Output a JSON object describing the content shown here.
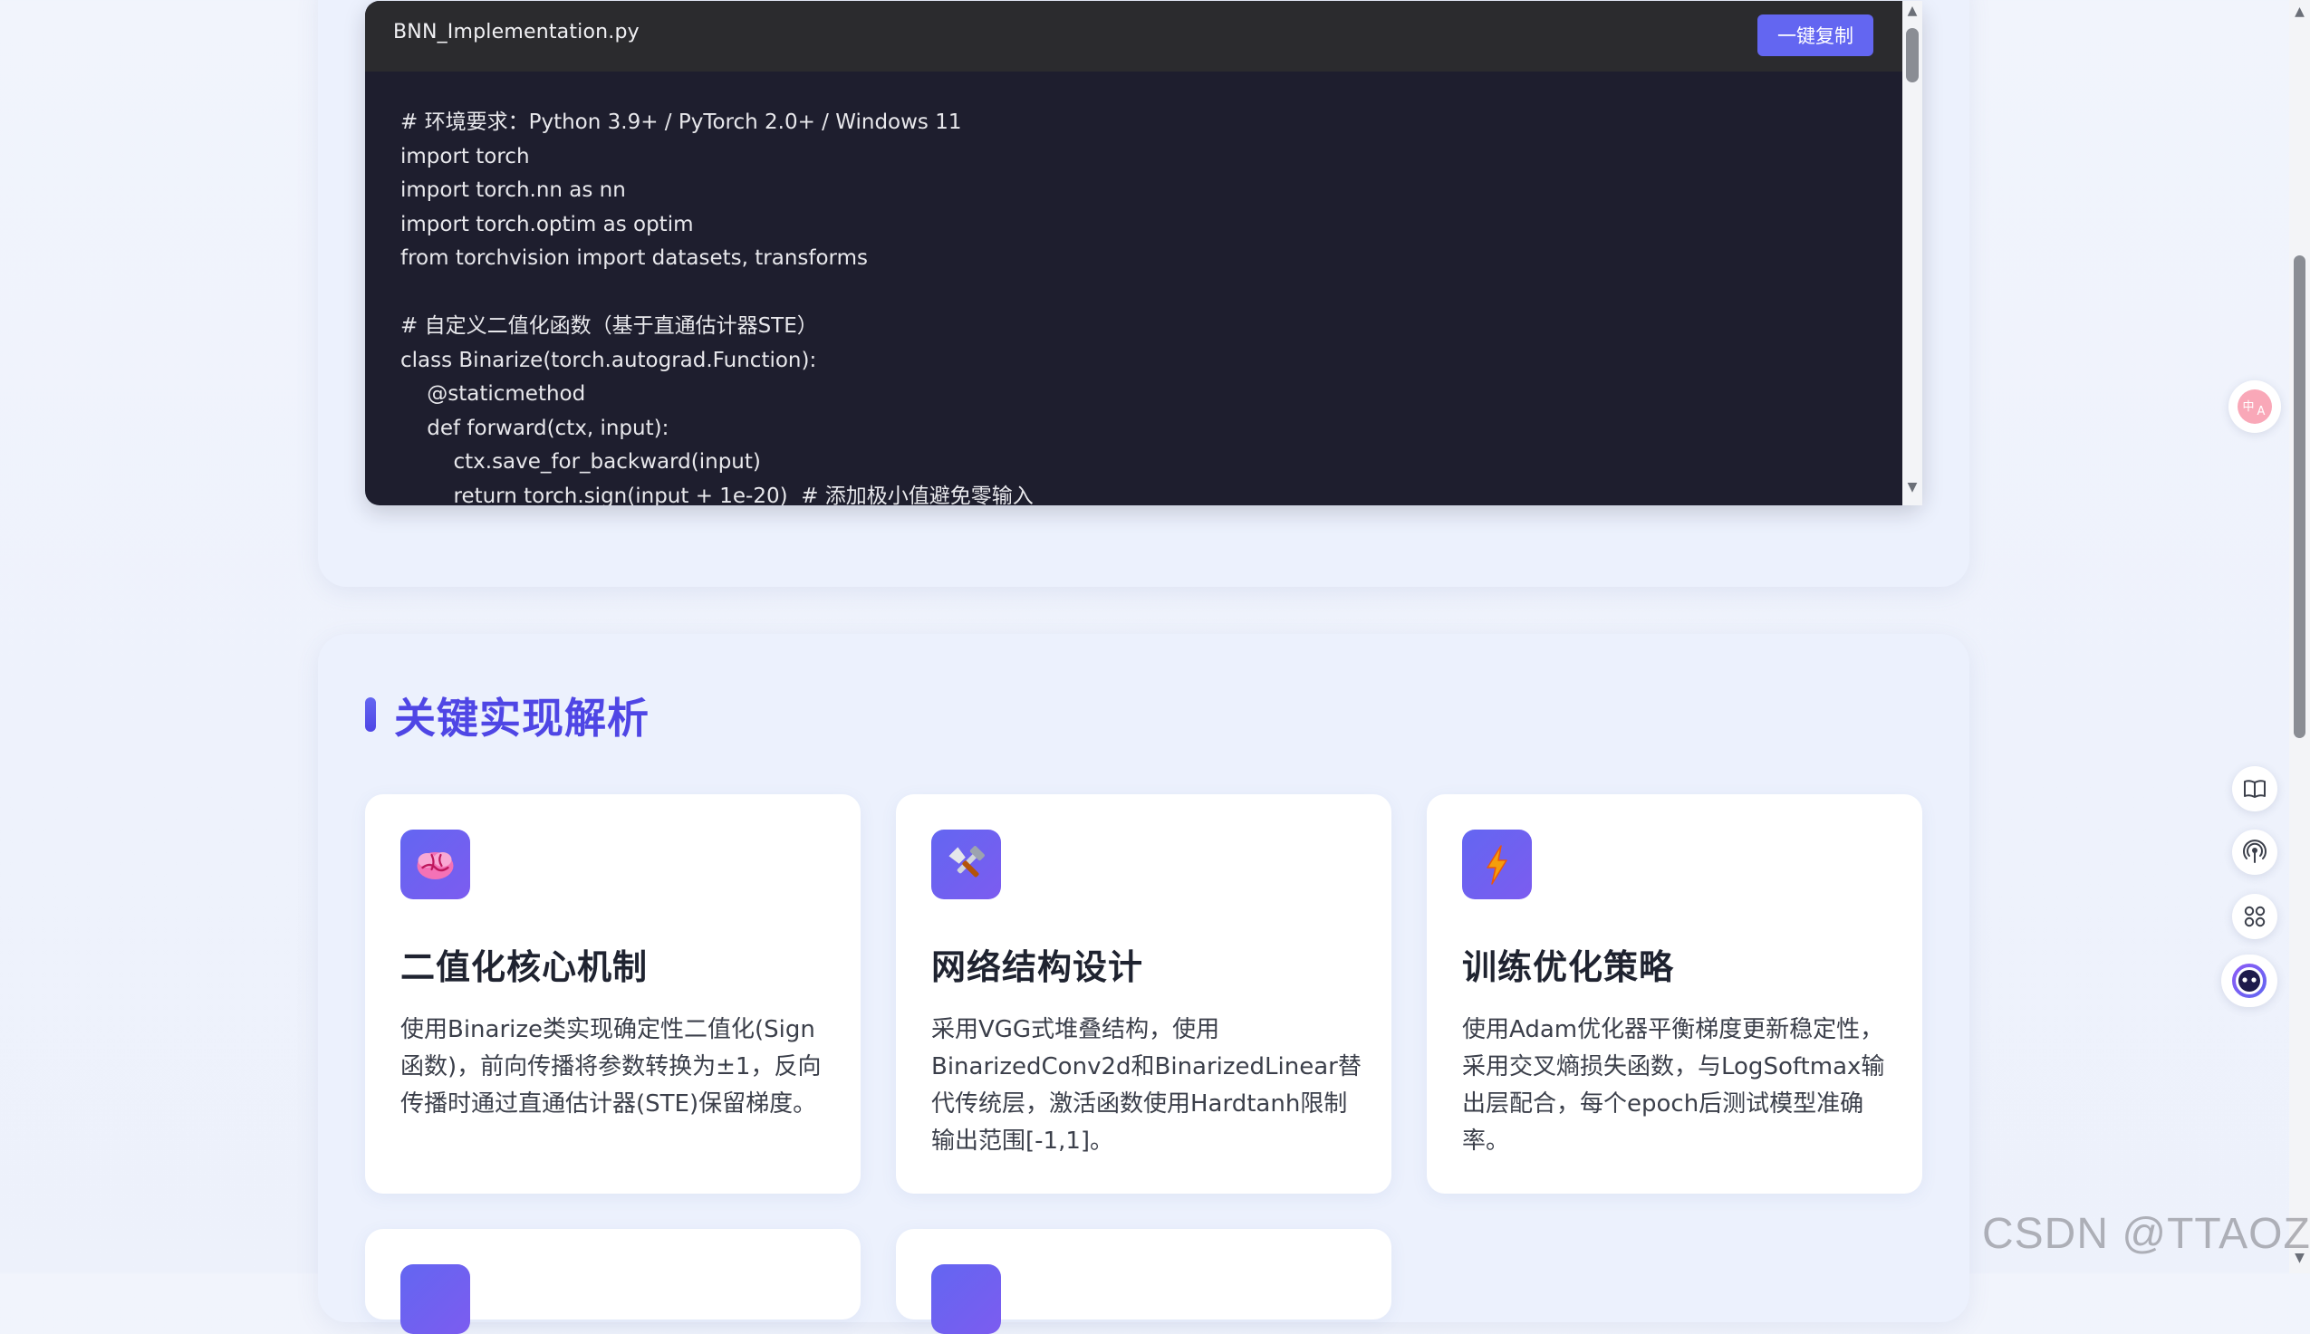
{
  "code_block": {
    "filename": "BNN_Implementation.py",
    "copy_label": "一键复制",
    "lines": [
      "# 环境要求：Python 3.9+ / PyTorch 2.0+ / Windows 11",
      "import torch",
      "import torch.nn as nn",
      "import torch.optim as optim",
      "from torchvision import datasets, transforms",
      "",
      "# 自定义二值化函数（基于直通估计器STE）",
      "class Binarize(torch.autograd.Function):",
      "    @staticmethod",
      "    def forward(ctx, input):",
      "        ctx.save_for_backward(input)",
      "        return torch.sign(input + 1e-20)  # 添加极小值避免零输入"
    ]
  },
  "analysis": {
    "title": "关键实现解析",
    "cards": [
      {
        "icon": "brain-icon",
        "title": "二值化核心机制",
        "desc": "使用Binarize类实现确定性二值化(Sign函数)，前向传播将参数转换为±1，反向传播时通过直通估计器(STE)保留梯度。"
      },
      {
        "icon": "tools-icon",
        "title": "网络结构设计",
        "desc": "采用VGG式堆叠结构，使用BinarizedConv2d和BinarizedLinear替代传统层，激活函数使用Hardtanh限制输出范围[-1,1]。"
      },
      {
        "icon": "lightning-icon",
        "title": "训练优化策略",
        "desc": "使用Adam优化器平衡梯度更新稳定性，采用交叉熵损失函数，与LogSoftmax输出层配合，每个epoch后测试模型准确率。"
      }
    ]
  },
  "side_tools": {
    "icons": [
      "translate-icon",
      "book-icon",
      "podcast-icon",
      "apps-icon",
      "assistant-icon"
    ]
  },
  "watermark": "CSDN @TTAOZZ",
  "colors": {
    "accent": "#6366f1",
    "title": "#4f46e5",
    "code_bg": "#1e1e2e",
    "code_header": "#2b2b2e"
  }
}
